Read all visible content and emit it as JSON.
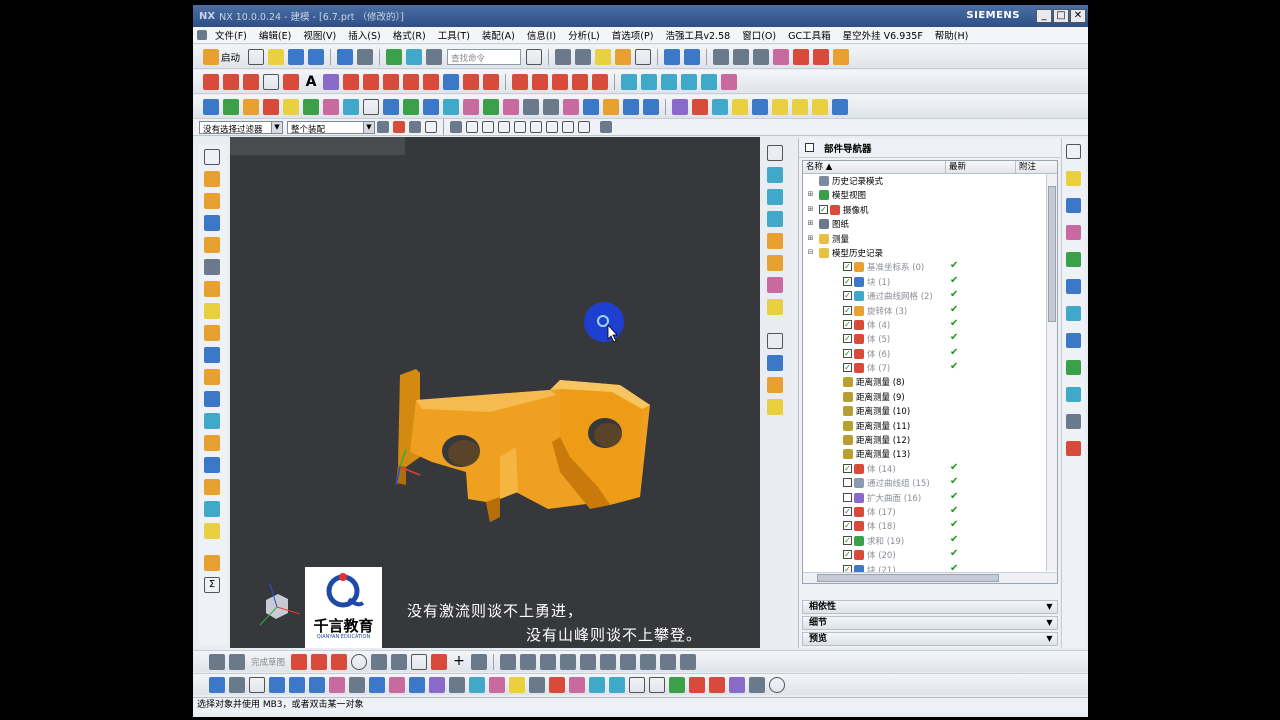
{
  "window": {
    "app": "NX 10.0.0.24 - 建模 - [6.7.prt （修改的）]",
    "brand": "SIEMENS",
    "buttons": [
      "_",
      "□",
      "✕"
    ]
  },
  "menu": [
    "文件(F)",
    "编辑(E)",
    "视图(V)",
    "插入(S)",
    "格式(R)",
    "工具(T)",
    "装配(A)",
    "信息(I)",
    "分析(L)",
    "首选项(P)",
    "浩强工具v2.58",
    "窗口(O)",
    "GC工具箱",
    "星空外挂 V6.935F",
    "帮助(H)"
  ],
  "toolbar": {
    "start_label": "启动",
    "search_placeholder": "查找命令"
  },
  "filter": {
    "selection_filter": "没有选择过滤器",
    "assembly_scope": "整个装配"
  },
  "sketch_bar": {
    "finish_label": "完成草图"
  },
  "navigator": {
    "title": "部件导航器",
    "columns": [
      "名称",
      "最新",
      "附注"
    ],
    "rows": [
      {
        "label": "历史记录模式",
        "indent": 0,
        "expander": "",
        "checkbox": "none",
        "icon": "history-icon",
        "uptodate": false,
        "grey": false
      },
      {
        "label": "模型视图",
        "indent": 0,
        "expander": "+",
        "checkbox": "none",
        "icon": "model-views-icon",
        "uptodate": false,
        "grey": false
      },
      {
        "label": "摄像机",
        "indent": 0,
        "expander": "+",
        "checkbox": "checked",
        "icon": "camera-icon",
        "uptodate": false,
        "grey": false
      },
      {
        "label": "图纸",
        "indent": 0,
        "expander": "+",
        "checkbox": "none",
        "icon": "drawing-icon",
        "uptodate": false,
        "grey": false
      },
      {
        "label": "测量",
        "indent": 0,
        "expander": "+",
        "checkbox": "none",
        "icon": "folder-icon",
        "uptodate": false,
        "grey": false
      },
      {
        "label": "模型历史记录",
        "indent": 0,
        "expander": "-",
        "checkbox": "none",
        "icon": "folder-icon",
        "uptodate": false,
        "grey": false
      },
      {
        "label": "基准坐标系 (0)",
        "indent": 1,
        "expander": "",
        "checkbox": "checked",
        "icon": "datum-csys-icon",
        "uptodate": true,
        "grey": true
      },
      {
        "label": "块 (1)",
        "indent": 1,
        "expander": "",
        "checkbox": "checked",
        "icon": "block-icon",
        "uptodate": true,
        "grey": true
      },
      {
        "label": "通过曲线网格 (2)",
        "indent": 1,
        "expander": "",
        "checkbox": "checked",
        "icon": "mesh-surface-icon",
        "uptodate": true,
        "grey": true
      },
      {
        "label": "旋转体 (3)",
        "indent": 1,
        "expander": "",
        "checkbox": "checked",
        "icon": "revolve-icon",
        "uptodate": true,
        "grey": true
      },
      {
        "label": "体 (4)",
        "indent": 1,
        "expander": "",
        "checkbox": "checked",
        "icon": "body-icon",
        "uptodate": true,
        "grey": true
      },
      {
        "label": "体 (5)",
        "indent": 1,
        "expander": "",
        "checkbox": "checked",
        "icon": "body-icon",
        "uptodate": true,
        "grey": true
      },
      {
        "label": "体 (6)",
        "indent": 1,
        "expander": "",
        "checkbox": "checked",
        "icon": "body-icon",
        "uptodate": true,
        "grey": true
      },
      {
        "label": "体 (7)",
        "indent": 1,
        "expander": "",
        "checkbox": "checked",
        "icon": "body-icon",
        "uptodate": true,
        "grey": true
      },
      {
        "label": "距离测量 (8)",
        "indent": 1,
        "expander": "",
        "checkbox": "none",
        "icon": "measure-icon",
        "uptodate": false,
        "grey": false
      },
      {
        "label": "距离测量 (9)",
        "indent": 1,
        "expander": "",
        "checkbox": "none",
        "icon": "measure-icon",
        "uptodate": false,
        "grey": false
      },
      {
        "label": "距离测量 (10)",
        "indent": 1,
        "expander": "",
        "checkbox": "none",
        "icon": "measure-icon",
        "uptodate": false,
        "grey": false
      },
      {
        "label": "距离测量 (11)",
        "indent": 1,
        "expander": "",
        "checkbox": "none",
        "icon": "measure-icon",
        "uptodate": false,
        "grey": false
      },
      {
        "label": "距离测量 (12)",
        "indent": 1,
        "expander": "",
        "checkbox": "none",
        "icon": "measure-icon",
        "uptodate": false,
        "grey": false
      },
      {
        "label": "距离测量 (13)",
        "indent": 1,
        "expander": "",
        "checkbox": "none",
        "icon": "measure-icon",
        "uptodate": false,
        "grey": false
      },
      {
        "label": "体 (14)",
        "indent": 1,
        "expander": "",
        "checkbox": "checked",
        "icon": "body-icon",
        "uptodate": true,
        "grey": true
      },
      {
        "label": "通过曲线组 (15)",
        "indent": 1,
        "expander": "",
        "checkbox": "unchecked",
        "icon": "curve-group-icon",
        "uptodate": true,
        "grey": true
      },
      {
        "label": "扩大曲面 (16)",
        "indent": 1,
        "expander": "",
        "checkbox": "unchecked",
        "icon": "enlarge-surface-icon",
        "uptodate": true,
        "grey": true
      },
      {
        "label": "体 (17)",
        "indent": 1,
        "expander": "",
        "checkbox": "checked",
        "icon": "body-icon",
        "uptodate": true,
        "grey": true
      },
      {
        "label": "体 (18)",
        "indent": 1,
        "expander": "",
        "checkbox": "checked",
        "icon": "body-icon",
        "uptodate": true,
        "grey": true
      },
      {
        "label": "求和 (19)",
        "indent": 1,
        "expander": "",
        "checkbox": "checked",
        "icon": "unite-icon",
        "uptodate": true,
        "grey": true
      },
      {
        "label": "体 (20)",
        "indent": 1,
        "expander": "",
        "checkbox": "checked",
        "icon": "body-icon",
        "uptodate": true,
        "grey": true
      },
      {
        "label": "块 (21)",
        "indent": 1,
        "expander": "",
        "checkbox": "checked",
        "icon": "block-icon",
        "uptodate": true,
        "grey": true
      }
    ],
    "sections": [
      "相依性",
      "细节",
      "预览"
    ]
  },
  "overlay": {
    "logo_main": "千言教育",
    "logo_sub": "QIANYAN EDUCATION",
    "subtitle_line1": "没有激流则谈不上勇进，",
    "subtitle_line2": "没有山峰则谈不上攀登。"
  },
  "status": "选择对象并使用 MB3，或者双击某一对象",
  "colors": {
    "viewport_bg": "#37383c",
    "part_orange": "#f0a020",
    "cursor_blue": "#1f3fd0"
  }
}
